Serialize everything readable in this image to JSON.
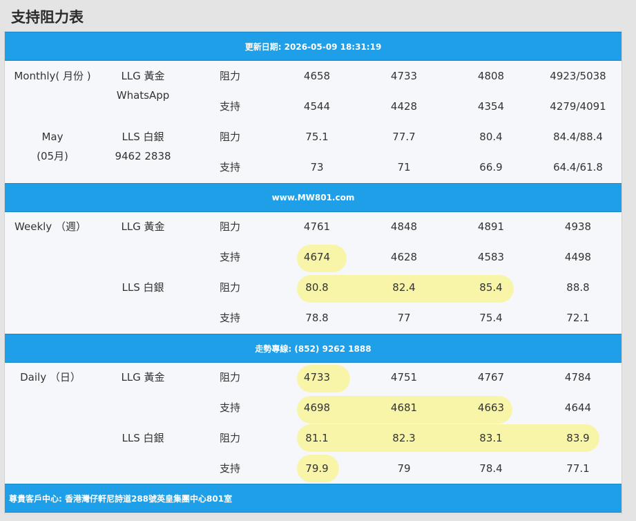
{
  "page_title": "支持阻力表",
  "bars": {
    "update": "更新日期: 2026-05-09 18:31:19",
    "website": "www.MW801.com",
    "hotline": "走勢專線: (852) 9262 1888",
    "address": "尊貴客戶中心: 香港灣仔軒尼詩道288號英皇集團中心801室"
  },
  "monthly": {
    "period": "Monthly( 月份 )",
    "month_en": "May",
    "month_cn": "(05月)",
    "gold_label": "LLG 黃金",
    "whatsapp_label": "WhatsApp",
    "silver_label": "LLS 白銀",
    "phone": "9462 2838",
    "rows": [
      {
        "type": "阻力",
        "values": [
          "4658",
          "4733",
          "4808",
          "4923/5038"
        ]
      },
      {
        "type": "支持",
        "values": [
          "4544",
          "4428",
          "4354",
          "4279/4091"
        ]
      },
      {
        "type": "阻力",
        "values": [
          "75.1",
          "77.7",
          "80.4",
          "84.4/88.4"
        ]
      },
      {
        "type": "支持",
        "values": [
          "73",
          "71",
          "66.9",
          "64.4/61.8"
        ]
      }
    ]
  },
  "weekly": {
    "period": "Weekly （週）",
    "gold_label": "LLG 黃金",
    "silver_label": "LLS 白銀",
    "rows": [
      {
        "type": "阻力",
        "values": [
          "4761",
          "4848",
          "4891",
          "4938"
        ]
      },
      {
        "type": "支持",
        "values": [
          "4674",
          "4628",
          "4583",
          "4498"
        ]
      },
      {
        "type": "阻力",
        "values": [
          "80.8",
          "82.4",
          "85.4",
          "88.8"
        ]
      },
      {
        "type": "支持",
        "values": [
          "78.8",
          "77",
          "75.4",
          "72.1"
        ]
      }
    ]
  },
  "daily": {
    "period": "Daily （日）",
    "gold_label": "LLG 黃金",
    "silver_label": "LLS 白銀",
    "rows": [
      {
        "type": "阻力",
        "values": [
          "4733",
          "4751",
          "4767",
          "4784"
        ]
      },
      {
        "type": "支持",
        "values": [
          "4698",
          "4681",
          "4663",
          "4644"
        ]
      },
      {
        "type": "阻力",
        "values": [
          "81.1",
          "82.3",
          "83.1",
          "83.9"
        ]
      },
      {
        "type": "支持",
        "values": [
          "79.9",
          "79",
          "78.4",
          "77.1"
        ]
      }
    ]
  },
  "colors": {
    "bar_blue": "#1e9fe7",
    "highlight_yellow": "#f8f5a8",
    "panel_bg": "#f6f7fb"
  }
}
